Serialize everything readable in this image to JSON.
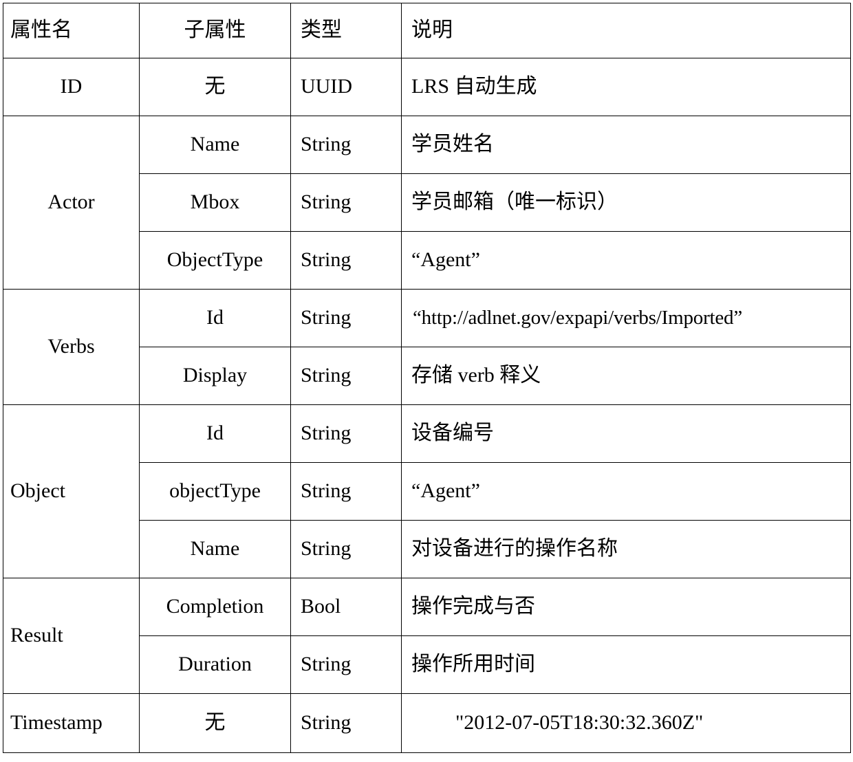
{
  "table": {
    "headers": {
      "attribute": "属性名",
      "sub_attribute": "子属性",
      "type": "类型",
      "description": "说明"
    },
    "rows": [
      {
        "attribute": "ID",
        "attribute_align": "center",
        "rowspan": 1,
        "subs": [
          {
            "sub": "无",
            "sub_align": "center",
            "type": "UUID",
            "description": "LRS 自动生成"
          }
        ]
      },
      {
        "attribute": "Actor",
        "attribute_align": "center",
        "rowspan": 3,
        "subs": [
          {
            "sub": "Name",
            "sub_align": "center",
            "type": "String",
            "description": "学员姓名"
          },
          {
            "sub": "Mbox",
            "sub_align": "center",
            "type": "String",
            "description": "学员邮箱（唯一标识）"
          },
          {
            "sub": "ObjectType",
            "sub_align": "center",
            "type": "String",
            "description": "“Agent”"
          }
        ]
      },
      {
        "attribute": "Verbs",
        "attribute_align": "center",
        "rowspan": 2,
        "subs": [
          {
            "sub": "Id",
            "sub_align": "center",
            "type": "String",
            "description": "“http://adlnet.gov/expapi/verbs/Imported”"
          },
          {
            "sub": "Display",
            "sub_align": "center",
            "type": "String",
            "description": "存储 verb 释义"
          }
        ]
      },
      {
        "attribute": "Object",
        "attribute_align": "left",
        "rowspan": 3,
        "subs": [
          {
            "sub": "Id",
            "sub_align": "center",
            "type": "String",
            "description": "设备编号"
          },
          {
            "sub": "objectType",
            "sub_align": "left",
            "type": "String",
            "description": "“Agent”"
          },
          {
            "sub": "Name",
            "sub_align": "center",
            "type": "String",
            "description": "对设备进行的操作名称"
          }
        ]
      },
      {
        "attribute": "Result",
        "attribute_align": "left",
        "rowspan": 2,
        "subs": [
          {
            "sub": "Completion",
            "sub_align": "left",
            "type": "Bool",
            "description": "操作完成与否"
          },
          {
            "sub": "Duration",
            "sub_align": "left",
            "type": "String",
            "description": "操作所用时间"
          }
        ]
      },
      {
        "attribute": "Timestamp",
        "attribute_align": "left",
        "rowspan": 1,
        "subs": [
          {
            "sub": "无",
            "sub_align": "center",
            "type": "String",
            "description": "\"2012-07-05T18:30:32.360Z\""
          }
        ]
      }
    ]
  },
  "colors": {
    "border": "#000000",
    "text": "#000000",
    "background": "#ffffff"
  }
}
